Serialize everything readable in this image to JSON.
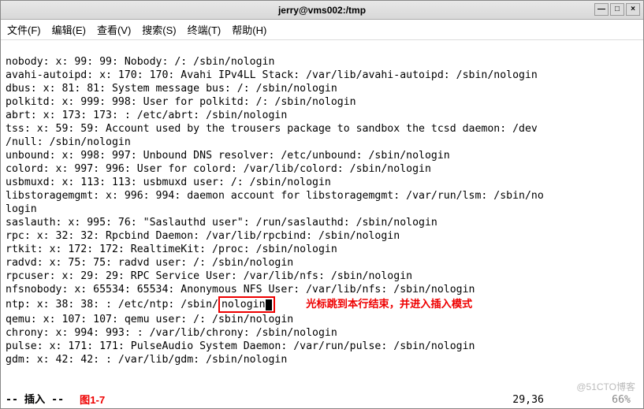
{
  "window": {
    "title": "jerry@vms002:/tmp"
  },
  "controls": {
    "min": "—",
    "max": "□",
    "close": "×"
  },
  "menu": {
    "file": "文件(F)",
    "edit": "编辑(E)",
    "view": "查看(V)",
    "search": "搜索(S)",
    "terminal": "终端(T)",
    "help": "帮助(H)"
  },
  "lines": {
    "l1": "nobody: x: 99: 99: Nobody: /: /sbin/nologin",
    "l2": "avahi-autoipd: x: 170: 170: Avahi IPv4LL Stack: /var/lib/avahi-autoipd: /sbin/nologin",
    "l3": "dbus: x: 81: 81: System message bus: /: /sbin/nologin",
    "l4": "polkitd: x: 999: 998: User for polkitd: /: /sbin/nologin",
    "l5": "abrt: x: 173: 173: : /etc/abrt: /sbin/nologin",
    "l6": "tss: x: 59: 59: Account used by the trousers package to sandbox the tcsd daemon: /dev",
    "l7": "/null: /sbin/nologin",
    "l8": "unbound: x: 998: 997: Unbound DNS resolver: /etc/unbound: /sbin/nologin",
    "l9": "colord: x: 997: 996: User for colord: /var/lib/colord: /sbin/nologin",
    "l10": "usbmuxd: x: 113: 113: usbmuxd user: /: /sbin/nologin",
    "l11": "libstoragemgmt: x: 996: 994: daemon account for libstoragemgmt: /var/run/lsm: /sbin/no",
    "l12": "login",
    "l13": "saslauth: x: 995: 76: \"Saslauthd user\": /run/saslauthd: /sbin/nologin",
    "l14": "rpc: x: 32: 32: Rpcbind Daemon: /var/lib/rpcbind: /sbin/nologin",
    "l15": "rtkit: x: 172: 172: RealtimeKit: /proc: /sbin/nologin",
    "l16": "radvd: x: 75: 75: radvd user: /: /sbin/nologin",
    "l17": "rpcuser: x: 29: 29: RPC Service User: /var/lib/nfs: /sbin/nologin",
    "l18": "nfsnobody: x: 65534: 65534: Anonymous NFS User: /var/lib/nfs: /sbin/nologin",
    "l19a": "ntp: x: 38: 38: : /etc/ntp: /sbin/",
    "l19b": "nologin",
    "l20": "qemu: x: 107: 107: qemu user: /: /sbin/nologin",
    "l21": "chrony: x: 994: 993: : /var/lib/chrony: /sbin/nologin",
    "l22": "pulse: x: 171: 171: PulseAudio System Daemon: /var/run/pulse: /sbin/nologin",
    "l23": "gdm: x: 42: 42: : /var/lib/gdm: /sbin/nologin"
  },
  "annotation": "光标跳到本行结束，并进入插入模式",
  "figure_label": "图1-7",
  "status": {
    "mode": "-- 插入 --",
    "position": "29,36",
    "percent": "66%"
  },
  "watermark": "@51CTO博客"
}
